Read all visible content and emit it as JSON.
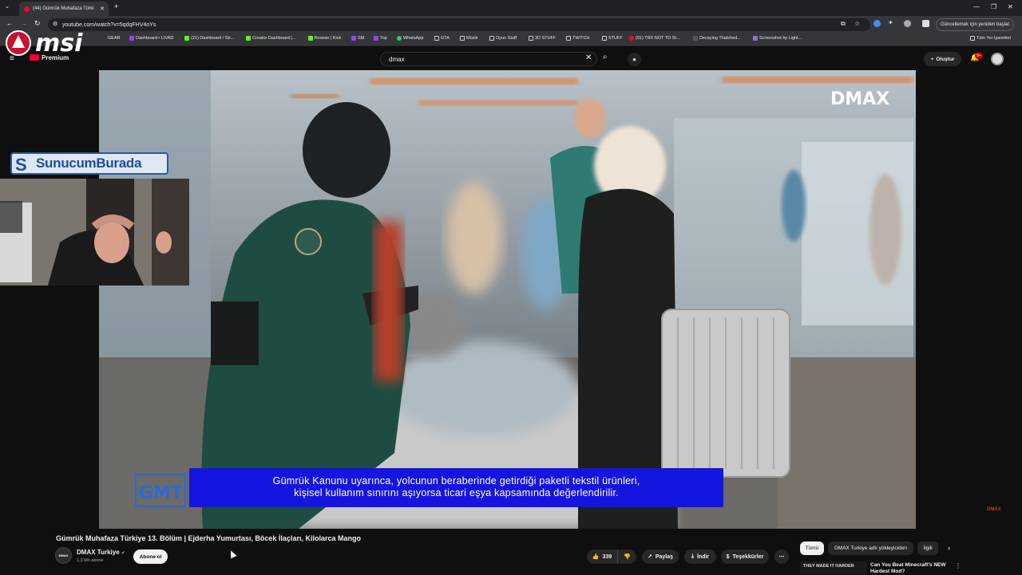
{
  "browser": {
    "tab_title": "(44) Gümrük Muhafaza Türki",
    "url": "youtube.com/watch?v=5qdqFHV4oYs",
    "update_label": "Güncellemek için yeniden başlat",
    "bookmarks": [
      "GEAR",
      "Dashboard • LIVAD",
      "(21) Dashboard / Str...",
      "Creator Dashboard |...",
      "Browse | Kick",
      "SM",
      "Top",
      "WhatsApp",
      "GTA",
      "Müzik",
      "Oyun Stuff",
      "3D STUFF",
      "TWITCH",
      "STUFF",
      "(91) TRX NOT TO SI...",
      "Decaying Thatched...",
      "Screenshot by Light..."
    ],
    "all_bookmarks_label": "Tüm Yer İşaretleri"
  },
  "overlay": {
    "brand_logo": "msi",
    "yt_premium_label": "Premium",
    "sunucum_label": "SunucumBurada"
  },
  "youtube": {
    "search_value": "dmax",
    "create_label": "Oluştur",
    "notif_count": "9+"
  },
  "video": {
    "watermark": "DMAX",
    "subtitle_line1": "Gümrük Kanunu uyarınca, yolcunun beraberinde getirdiği paketli tekstil ürünleri,",
    "subtitle_line2": "kişisel kullanım sınırını aşıyorsa ticari eşya kapsamında değerlendirilir.",
    "gmt_logo": "GMT",
    "corner_logo": "DMAX"
  },
  "info": {
    "title": "Gümrük Muhafaza Türkiye 13. Bölüm | Ejderha Yumurtası, Böcek İlaçları, Kilolarca Mango",
    "channel_avatar_text": "DMAX",
    "channel_name": "DMAX Turkiye",
    "subs": "1,3 Mn abone",
    "subscribe_label": "Abone ol",
    "likes": "339",
    "share_label": "Paylaş",
    "download_label": "İndir",
    "thanks_label": "Teşekkürler",
    "more_label": "⋯"
  },
  "sidebar": {
    "chips": [
      "Tümü",
      "DMAX Turkiye adlı yükleyiciden",
      "İlgili"
    ],
    "rec_thumb_text": "THEY MADE IT HARDER",
    "rec_title": "Can You Beat Minecraft's NEW Hardest Mod?"
  }
}
